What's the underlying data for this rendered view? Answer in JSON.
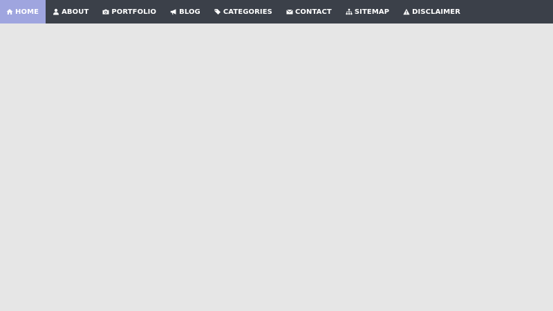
{
  "navbar": {
    "colors": {
      "background": "#3b4049",
      "active_background": "#9fa5df",
      "text": "#ffffff",
      "page_background": "#e6e6e6"
    },
    "items": [
      {
        "label": "HOME",
        "icon": "home-icon",
        "active": true
      },
      {
        "label": "ABOUT",
        "icon": "user-icon",
        "active": false
      },
      {
        "label": "PORTFOLIO",
        "icon": "camera-icon",
        "active": false
      },
      {
        "label": "BLOG",
        "icon": "bullhorn-icon",
        "active": false
      },
      {
        "label": "CATEGORIES",
        "icon": "tags-icon",
        "active": false
      },
      {
        "label": "CONTACT",
        "icon": "envelope-icon",
        "active": false
      },
      {
        "label": "SITEMAP",
        "icon": "sitemap-icon",
        "active": false
      },
      {
        "label": "DISCLAIMER",
        "icon": "warning-icon",
        "active": false
      }
    ]
  }
}
